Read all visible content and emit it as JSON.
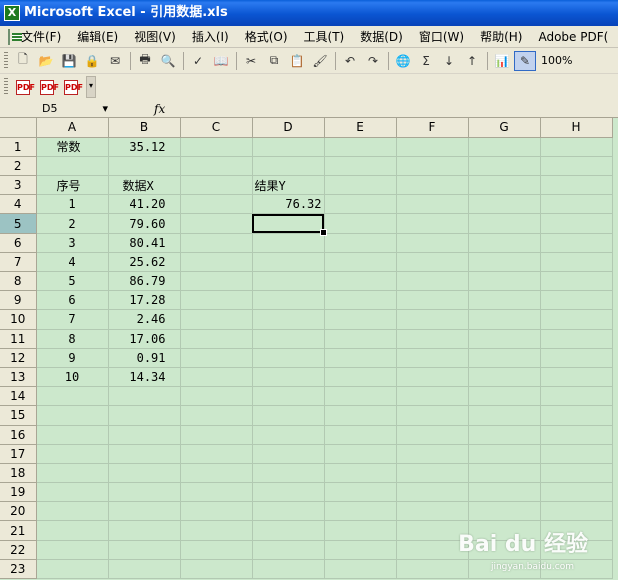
{
  "window": {
    "title": "Microsoft Excel - 引用数据.xls"
  },
  "menu": [
    "文件(F)",
    "编辑(E)",
    "视图(V)",
    "插入(I)",
    "格式(O)",
    "工具(T)",
    "数据(D)",
    "窗口(W)",
    "帮助(H)",
    "Adobe PDF("
  ],
  "toolbar": {
    "zoom": "100%",
    "icons": [
      "new-icon",
      "open-icon",
      "save-icon",
      "permission-icon",
      "mail-icon",
      "print-icon",
      "print-preview-icon",
      "spelling-icon",
      "research-icon",
      "cut-icon",
      "copy-icon",
      "paste-icon",
      "format-painter-icon",
      "undo-icon",
      "redo-icon",
      "hyperlink-icon",
      "autosum-icon",
      "sort-ascending-icon",
      "sort-descending-icon",
      "chart-wizard-icon",
      "drawing-icon"
    ]
  },
  "formula_bar": {
    "name_box": "D5",
    "fx_label": "fx",
    "content": ""
  },
  "sheet": {
    "columns": [
      "A",
      "B",
      "C",
      "D",
      "E",
      "F",
      "G",
      "H"
    ],
    "active_col": "D",
    "active_row": 5,
    "selected_cell": "D5",
    "rows": [
      {
        "num": "1",
        "A": "常数",
        "B": "35.12",
        "C": "",
        "D": ""
      },
      {
        "num": "2",
        "A": "",
        "B": "",
        "C": "",
        "D": ""
      },
      {
        "num": "3",
        "A": "序号",
        "B": "数据X",
        "C": "",
        "D": "结果Y"
      },
      {
        "num": "4",
        "A": "1",
        "B": "41.20",
        "C": "",
        "D": "76.32"
      },
      {
        "num": "5",
        "A": "2",
        "B": "79.60",
        "C": "",
        "D": ""
      },
      {
        "num": "6",
        "A": "3",
        "B": "80.41",
        "C": "",
        "D": ""
      },
      {
        "num": "7",
        "A": "4",
        "B": "25.62",
        "C": "",
        "D": ""
      },
      {
        "num": "8",
        "A": "5",
        "B": "86.79",
        "C": "",
        "D": ""
      },
      {
        "num": "9",
        "A": "6",
        "B": "17.28",
        "C": "",
        "D": ""
      },
      {
        "num": "10",
        "A": "7",
        "B": "2.46",
        "C": "",
        "D": ""
      },
      {
        "num": "11",
        "A": "8",
        "B": "17.06",
        "C": "",
        "D": ""
      },
      {
        "num": "12",
        "A": "9",
        "B": "0.91",
        "C": "",
        "D": ""
      },
      {
        "num": "13",
        "A": "10",
        "B": "14.34",
        "C": "",
        "D": ""
      },
      {
        "num": "14",
        "A": "",
        "B": "",
        "C": "",
        "D": ""
      },
      {
        "num": "15",
        "A": "",
        "B": "",
        "C": "",
        "D": ""
      },
      {
        "num": "16",
        "A": "",
        "B": "",
        "C": "",
        "D": ""
      },
      {
        "num": "17",
        "A": "",
        "B": "",
        "C": "",
        "D": ""
      },
      {
        "num": "18",
        "A": "",
        "B": "",
        "C": "",
        "D": ""
      },
      {
        "num": "19",
        "A": "",
        "B": "",
        "C": "",
        "D": ""
      },
      {
        "num": "20",
        "A": "",
        "B": "",
        "C": "",
        "D": ""
      },
      {
        "num": "21",
        "A": "",
        "B": "",
        "C": "",
        "D": ""
      },
      {
        "num": "22",
        "A": "",
        "B": "",
        "C": "",
        "D": ""
      },
      {
        "num": "23",
        "A": "",
        "B": "",
        "C": "",
        "D": ""
      }
    ]
  },
  "watermark": {
    "text": "Bai du 经验",
    "sub": "jingyan.baidu.com"
  },
  "colors": {
    "sheet_background": "#cce8cc",
    "title_bar": "#0a55d2",
    "active_header": "#9cc3c3"
  }
}
